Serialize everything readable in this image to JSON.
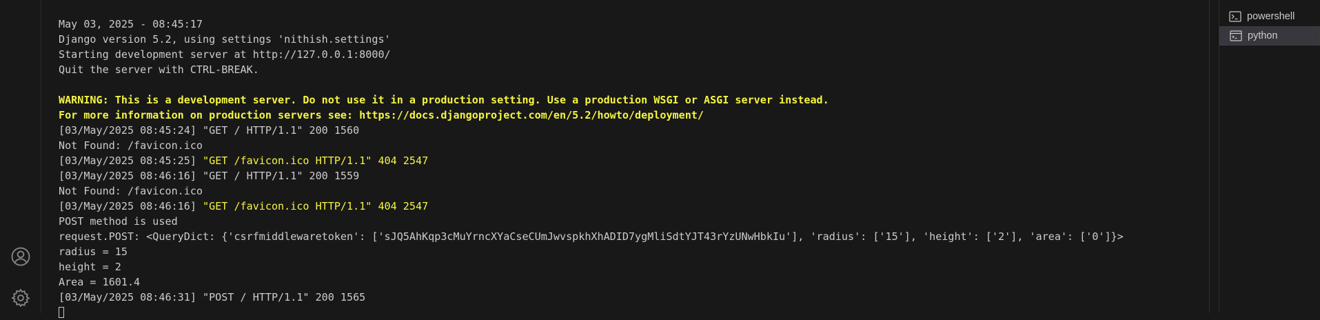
{
  "terminal": {
    "lines": [
      {
        "text": "May 03, 2025 - 08:45:17"
      },
      {
        "text": "Django version 5.2, using settings 'nithish.settings'"
      },
      {
        "text": "Starting development server at http://127.0.0.1:8000/"
      },
      {
        "text": "Quit the server with CTRL-BREAK."
      },
      {
        "text": ""
      },
      {
        "text": "WARNING: This is a development server. Do not use it in a production setting. Use a production WSGI or ASGI server instead.",
        "style": "warn"
      },
      {
        "text": "For more information on production servers see: https://docs.djangoproject.com/en/5.2/howto/deployment/",
        "style": "warn"
      },
      {
        "text": "[03/May/2025 08:45:24] \"GET / HTTP/1.1\" 200 1560"
      },
      {
        "text": "Not Found: /favicon.ico"
      },
      {
        "prefix": "[03/May/2025 08:45:25] ",
        "highlight": "\"GET /favicon.ico HTTP/1.1\" 404 2547"
      },
      {
        "text": "[03/May/2025 08:46:16] \"GET / HTTP/1.1\" 200 1559"
      },
      {
        "text": "Not Found: /favicon.ico"
      },
      {
        "prefix": "[03/May/2025 08:46:16] ",
        "highlight": "\"GET /favicon.ico HTTP/1.1\" 404 2547"
      },
      {
        "text": "POST method is used"
      },
      {
        "text": "request.POST: <QueryDict: {'csrfmiddlewaretoken': ['sJQ5AhKqp3cMuYrncXYaCseCUmJwvspkhXhADID7ygMliSdtYJT43rYzUNwHbkIu'], 'radius': ['15'], 'height': ['2'], 'area': ['0']}>"
      },
      {
        "text": "radius = 15"
      },
      {
        "text": "height = 2"
      },
      {
        "text": "Area = 1601.4"
      },
      {
        "text": "[03/May/2025 08:46:31] \"POST / HTTP/1.1\" 200 1565"
      }
    ]
  },
  "terminal_tabs": [
    {
      "label": "powershell",
      "icon": "terminal-icon",
      "active": false
    },
    {
      "label": "python",
      "icon": "console-window-icon",
      "active": true
    }
  ],
  "activity_bar": {
    "icons": [
      "account-icon",
      "settings-gear-icon"
    ]
  },
  "colors": {
    "background": "#181818",
    "text": "#cccccc",
    "warning": "#f5f543",
    "accent": "#0078d4"
  }
}
